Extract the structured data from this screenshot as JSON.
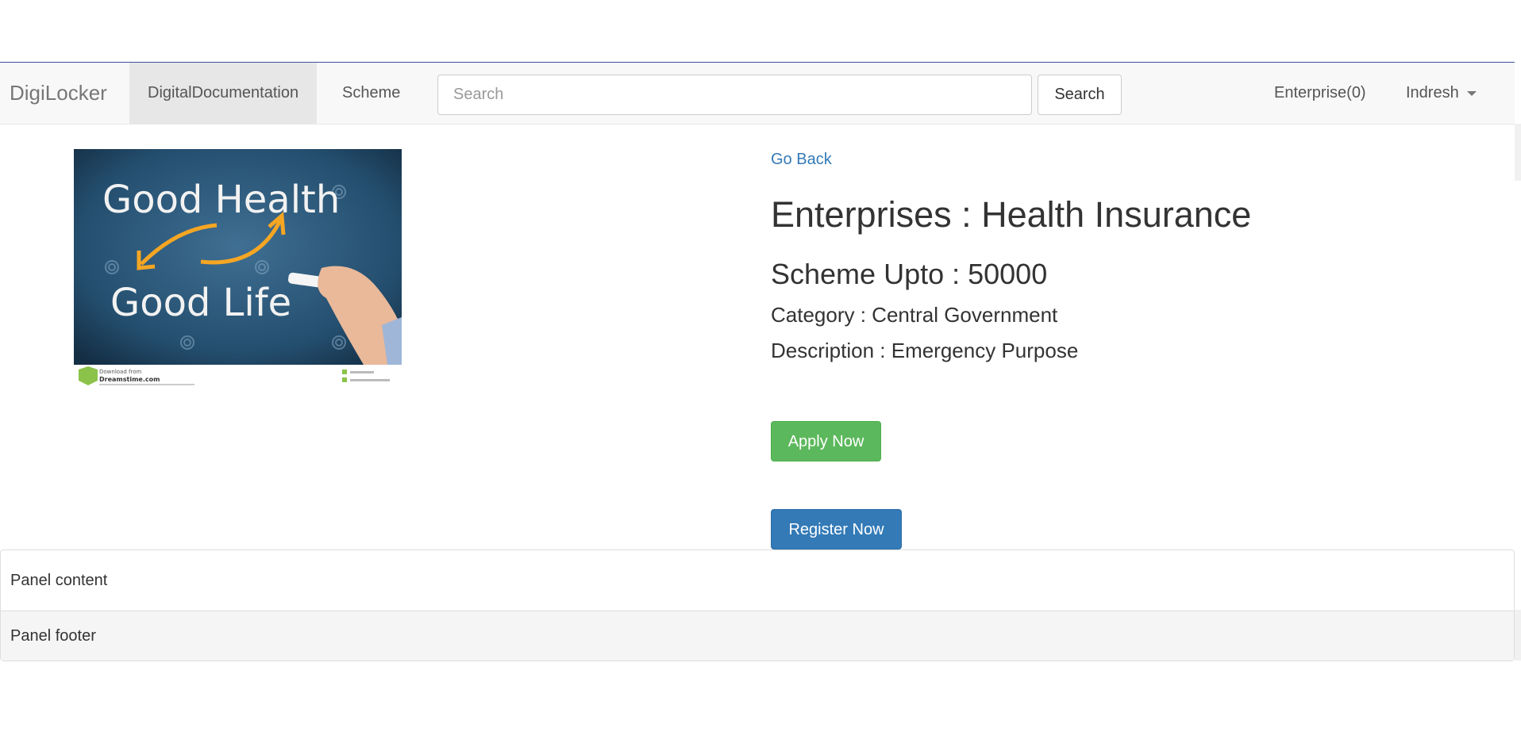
{
  "navbar": {
    "brand": "DigiLocker",
    "items": [
      {
        "label": "DigitalDocumentation",
        "active": true
      },
      {
        "label": "Scheme",
        "active": false
      }
    ],
    "search": {
      "placeholder": "Search",
      "value": "",
      "button_label": "Search"
    },
    "enterprise_label": "Enterprise(0)",
    "user_label": "Indresh"
  },
  "image": {
    "text_line1": "Good Health",
    "text_line2": "Good Life",
    "footer_small": "Download from",
    "footer_site": "Dreamstime.com",
    "icon": "good-health-chalkboard"
  },
  "detail": {
    "go_back": "Go Back",
    "title": "Enterprises : Health Insurance",
    "scheme_upto": "Scheme Upto : 50000",
    "category": "Category : Central Government",
    "description": "Description : Emergency Purpose",
    "apply_button": "Apply Now",
    "register_button": "Register Now"
  },
  "panel": {
    "content": "Panel content",
    "footer": "Panel footer"
  },
  "colors": {
    "success": "#5cb85c",
    "primary": "#337ab7",
    "link": "#337ab7"
  }
}
